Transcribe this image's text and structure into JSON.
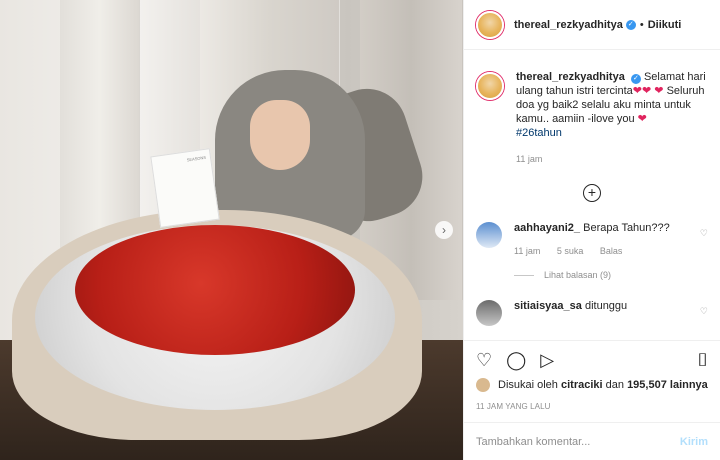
{
  "header": {
    "username": "thereal_rezkyadhitya",
    "separator": "•",
    "follow_label": "Diikuti"
  },
  "caption": {
    "username": "thereal_rezkyadhitya",
    "text_part1": "Selamat hari ulang tahun istri tercinta",
    "text_part2": "Seluruh doa yg baik2 selalu aku minta untuk kamu.. aamiin -ilove you",
    "heart": "❤",
    "hashtag": "#26tahun",
    "time": "11 jam"
  },
  "comments": [
    {
      "username": "aahhayani2_",
      "text": "Berapa Tahun???",
      "time": "11 jam",
      "likes": "5 suka",
      "reply_label": "Balas",
      "view_replies": "Lihat balasan (9)"
    },
    {
      "username": "sitiaisyaa_sa",
      "text": "ditunggu"
    }
  ],
  "photo": {
    "card_text": "SEASONS"
  },
  "actions": {
    "like_icon": "♡",
    "comment_icon": "◯",
    "share_icon": "▷",
    "save_icon": "⌷"
  },
  "likes": {
    "prefix": "Disukai oleh",
    "liker": "citraciki",
    "middle": "dan",
    "count": "195,507",
    "suffix": "lainnya"
  },
  "post_time": "11 JAM YANG LALU",
  "composer": {
    "placeholder": "Tambahkan komentar...",
    "post_label": "Kirim"
  },
  "colors": {
    "verified": "#3897f0",
    "heart": "#e0245e",
    "hashtag": "#00376b",
    "post_button": "#b2dffc"
  }
}
